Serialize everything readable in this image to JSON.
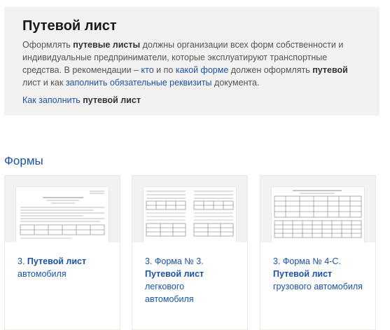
{
  "info": {
    "title": "Путевой лист",
    "text_1": "Оформлять ",
    "text_bold_1": "путевые листы",
    "text_2": " должны организации всех форм собственности и индивидуальные предприниматели, которые эксплуатируют транспортные средства. В рекомендации – ",
    "link_who": "кто",
    "text_3": " и по ",
    "link_which_form": "какой форме",
    "text_4": " должен оформлять ",
    "text_bold_2": "путевой",
    "text_5": " лист и как ",
    "link_fill": "заполнить",
    "link_required": "обязательные реквизиты",
    "text_6": " документа.",
    "how_to_prefix": "Как заполнить ",
    "how_to_bold": "путевой лист"
  },
  "section": {
    "title": "Формы"
  },
  "cards": [
    {
      "prefix": "3. ",
      "bold": "Путевой лист",
      "rest": " автомобиля"
    },
    {
      "prefix": "3. Форма № 3. ",
      "bold": "Путевой лист",
      "rest": " легкового автомобиля"
    },
    {
      "prefix": "3. Форма № 4-С. ",
      "bold": "Путевой лист",
      "rest": " грузового автомобиля"
    }
  ],
  "colors": {
    "accent": "#1a52a8",
    "box_bg": "#f4f2f0"
  }
}
